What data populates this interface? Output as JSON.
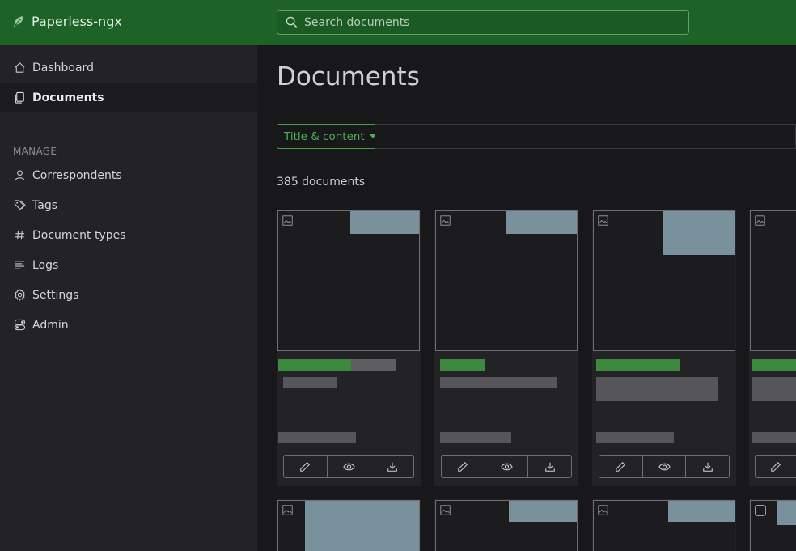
{
  "app": {
    "name": "Paperless-ngx",
    "logo_icon": "leaf-icon"
  },
  "search": {
    "placeholder": "Search documents",
    "icon": "search-icon"
  },
  "sidebar": {
    "items": [
      {
        "label": "Dashboard",
        "icon": "house-icon",
        "active": false
      },
      {
        "label": "Documents",
        "icon": "files-icon",
        "active": true
      }
    ],
    "manage_header": "MANAGE",
    "manage_items": [
      {
        "label": "Correspondents",
        "icon": "person-icon"
      },
      {
        "label": "Tags",
        "icon": "tags-icon"
      },
      {
        "label": "Document types",
        "icon": "hash-icon"
      },
      {
        "label": "Logs",
        "icon": "text-lines-icon"
      },
      {
        "label": "Settings",
        "icon": "gear-icon"
      },
      {
        "label": "Admin",
        "icon": "toggles-icon"
      }
    ]
  },
  "main": {
    "title": "Documents",
    "filter_mode_label": "Title & content",
    "document_count": "385 documents",
    "card_actions": [
      "edit-icon",
      "preview-icon",
      "download-icon"
    ]
  },
  "colors": {
    "topbar": "#1d6327",
    "accent": "#4bb154",
    "sidebar_bg": "#232326",
    "main_bg": "#18181a"
  }
}
